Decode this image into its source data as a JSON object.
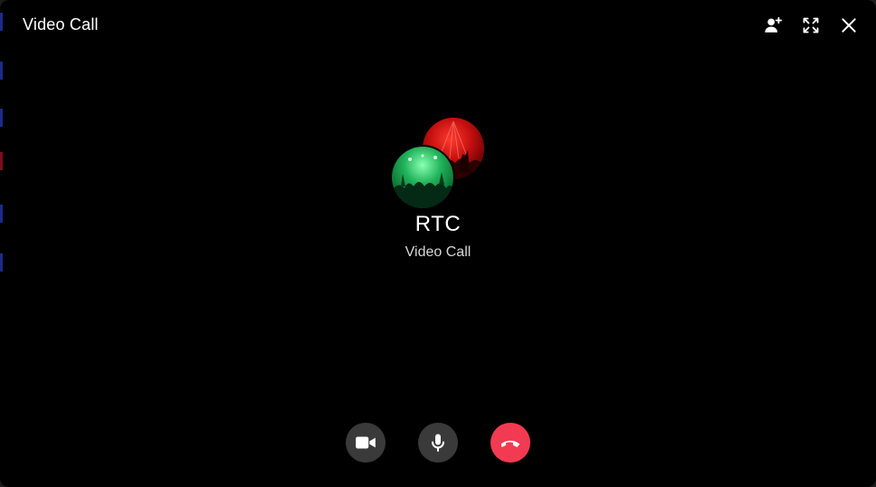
{
  "window": {
    "title": "Video Call"
  },
  "top_actions": [
    {
      "name": "add-participant-button",
      "icon": "person-add-icon"
    },
    {
      "name": "fullscreen-button",
      "icon": "fullscreen-icon"
    },
    {
      "name": "close-button",
      "icon": "close-icon"
    }
  ],
  "call": {
    "name": "RTC",
    "status": "Video Call"
  },
  "controls": [
    {
      "name": "camera-toggle-button",
      "icon": "video-camera-icon",
      "color": "#3a3a3a"
    },
    {
      "name": "microphone-toggle-button",
      "icon": "microphone-icon",
      "color": "#3a3a3a"
    },
    {
      "name": "hang-up-button",
      "icon": "phone-hangup-icon",
      "color": "#f23b52"
    }
  ],
  "colors": {
    "background": "#000000",
    "text_primary": "#ffffff",
    "text_secondary": "#d6d6d6",
    "hangup": "#f23b52",
    "control_gray": "#3a3a3a"
  }
}
